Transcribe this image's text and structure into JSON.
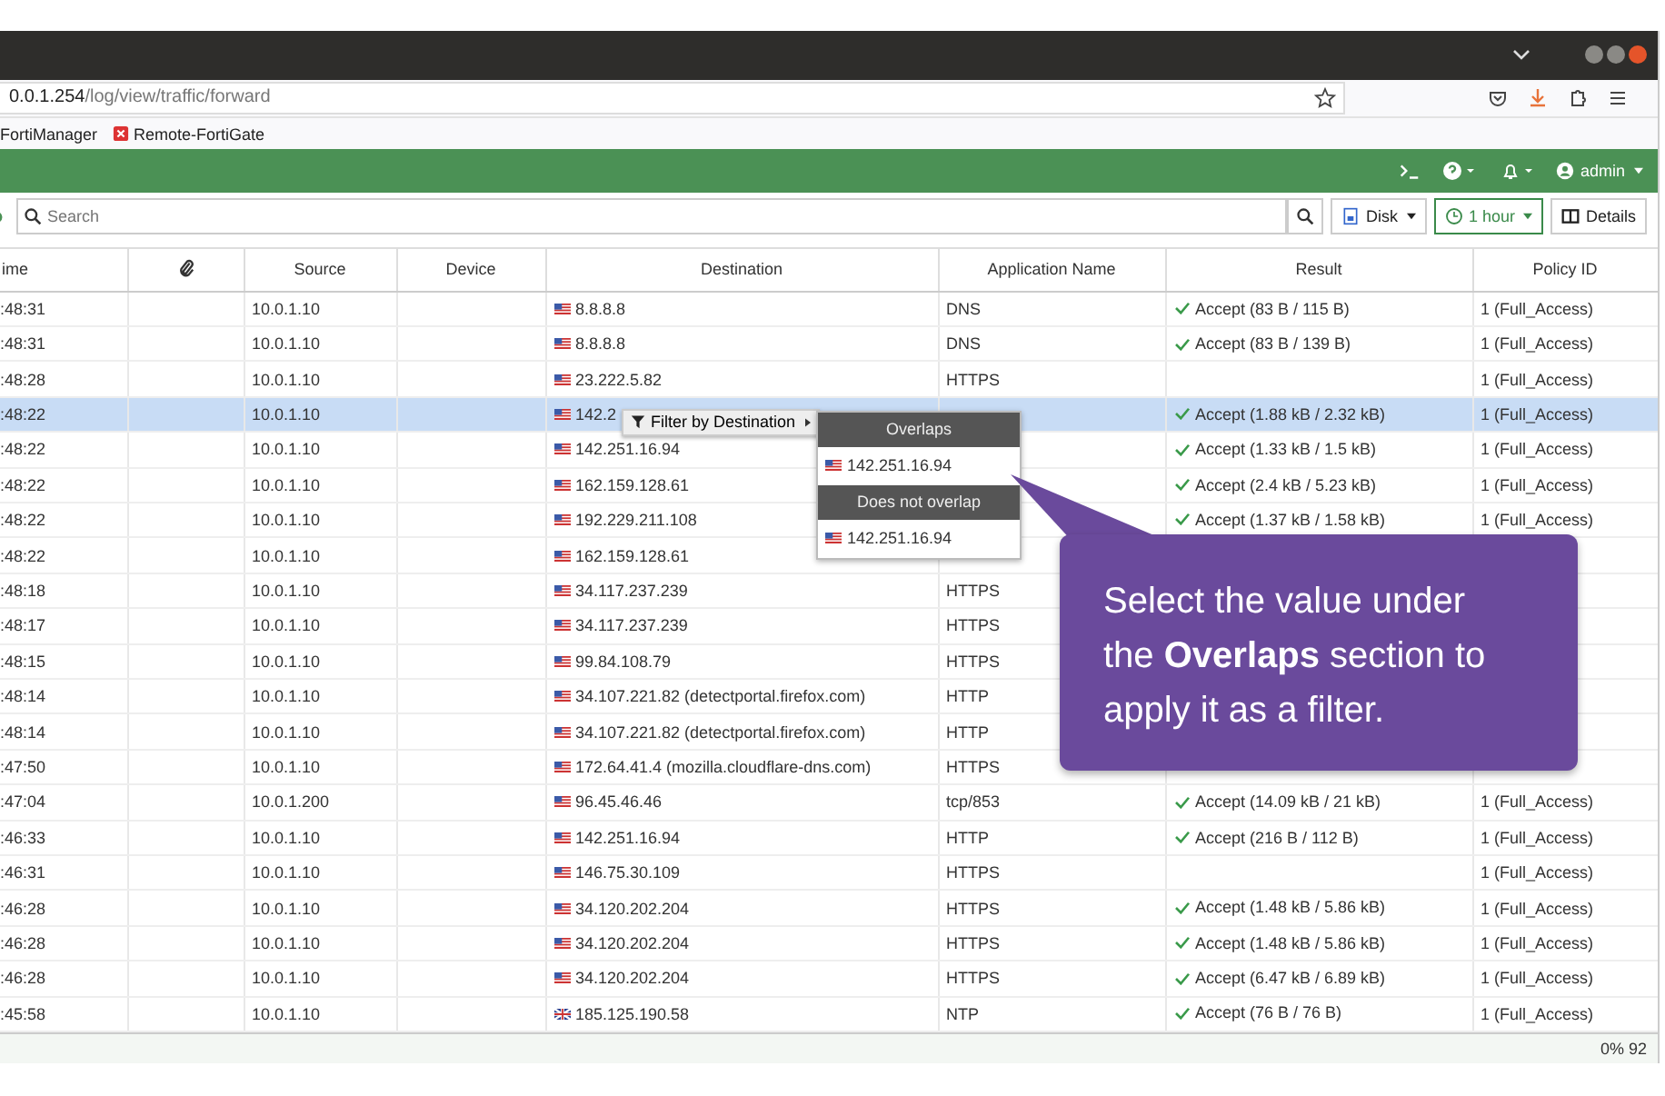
{
  "browser": {
    "url_host": "0.0.1.254",
    "url_path": "/log/view/traffic/forward",
    "bookmarks": [
      {
        "label": "FortiManager",
        "kind": "plain"
      },
      {
        "label": "Remote-FortiGate",
        "kind": "red"
      }
    ]
  },
  "header": {
    "user": "admin"
  },
  "toolbar": {
    "search": {
      "placeholder": "Search"
    },
    "disk": "Disk",
    "time_range": "1 hour",
    "details": "Details"
  },
  "table": {
    "columns": [
      "ime",
      "",
      "Source",
      "Device",
      "Destination",
      "Application Name",
      "Result",
      "Policy ID"
    ],
    "rows": [
      {
        "time": ":48:31",
        "source": "10.0.1.10",
        "dest": "8.8.8.8",
        "kind": "us",
        "app": "DNS",
        "result": "Accept (83 B / 115 B)",
        "policy": "1 (Full_Access)",
        "selected": false
      },
      {
        "time": ":48:31",
        "source": "10.0.1.10",
        "dest": "8.8.8.8",
        "kind": "us",
        "app": "DNS",
        "result": "Accept (83 B / 139 B)",
        "policy": "1 (Full_Access)",
        "selected": false
      },
      {
        "time": ":48:28",
        "source": "10.0.1.10",
        "dest": "23.222.5.82",
        "kind": "us",
        "app": "HTTPS",
        "policy": "1 (Full_Access)",
        "selected": false
      },
      {
        "time": ":48:22",
        "source": "10.0.1.10",
        "dest": "142.2",
        "kind": "us",
        "result": "Accept (1.88 kB / 2.32 kB)",
        "policy": "1 (Full_Access)",
        "selected": true
      },
      {
        "time": ":48:22",
        "source": "10.0.1.10",
        "dest": "142.251.16.94",
        "kind": "us",
        "result": "Accept (1.33 kB / 1.5 kB)",
        "policy": "1 (Full_Access)",
        "selected": false
      },
      {
        "time": ":48:22",
        "source": "10.0.1.10",
        "dest": "162.159.128.61",
        "kind": "us",
        "result": "Accept (2.4 kB / 5.23 kB)",
        "policy": "1 (Full_Access)",
        "selected": false
      },
      {
        "time": ":48:22",
        "source": "10.0.1.10",
        "dest": "192.229.211.108",
        "kind": "us",
        "result": "Accept (1.37 kB / 1.58 kB)",
        "policy": "1 (Full_Access)",
        "selected": false
      },
      {
        "time": ":48:22",
        "source": "10.0.1.10",
        "dest": "162.159.128.61",
        "kind": "us",
        "selected": false
      },
      {
        "time": ":48:18",
        "source": "10.0.1.10",
        "dest": "34.117.237.239",
        "kind": "us",
        "app": "HTTPS",
        "selected": false
      },
      {
        "time": ":48:17",
        "source": "10.0.1.10",
        "dest": "34.117.237.239",
        "kind": "us",
        "app": "HTTPS",
        "selected": false
      },
      {
        "time": ":48:15",
        "source": "10.0.1.10",
        "dest": "99.84.108.79",
        "kind": "us",
        "app": "HTTPS",
        "selected": false
      },
      {
        "time": ":48:14",
        "source": "10.0.1.10",
        "dest": "34.107.221.82 (detectportal.firefox.com)",
        "kind": "us",
        "app": "HTTP",
        "selected": false
      },
      {
        "time": ":48:14",
        "source": "10.0.1.10",
        "dest": "34.107.221.82 (detectportal.firefox.com)",
        "kind": "us",
        "app": "HTTP",
        "selected": false
      },
      {
        "time": ":47:50",
        "source": "10.0.1.10",
        "dest": "172.64.41.4 (mozilla.cloudflare-dns.com)",
        "kind": "us",
        "app": "HTTPS",
        "selected": false
      },
      {
        "time": ":47:04",
        "source": "10.0.1.200",
        "dest": "96.45.46.46",
        "kind": "us",
        "app": "tcp/853",
        "result": "Accept (14.09 kB / 21 kB)",
        "policy": "1 (Full_Access)",
        "selected": false
      },
      {
        "time": ":46:33",
        "source": "10.0.1.10",
        "dest": "142.251.16.94",
        "kind": "us",
        "app": "HTTP",
        "result": "Accept (216 B / 112 B)",
        "policy": "1 (Full_Access)",
        "selected": false
      },
      {
        "time": ":46:31",
        "source": "10.0.1.10",
        "dest": "146.75.30.109",
        "kind": "us",
        "app": "HTTPS",
        "policy": "1 (Full_Access)",
        "selected": false
      },
      {
        "time": ":46:28",
        "source": "10.0.1.10",
        "dest": "34.120.202.204",
        "kind": "us",
        "app": "HTTPS",
        "result": "Accept (1.48 kB / 5.86 kB)",
        "policy": "1 (Full_Access)",
        "selected": false
      },
      {
        "time": ":46:28",
        "source": "10.0.1.10",
        "dest": "34.120.202.204",
        "kind": "us",
        "app": "HTTPS",
        "result": "Accept (1.48 kB / 5.86 kB)",
        "policy": "1 (Full_Access)",
        "selected": false
      },
      {
        "time": ":46:28",
        "source": "10.0.1.10",
        "dest": "34.120.202.204",
        "kind": "us",
        "app": "HTTPS",
        "result": "Accept (6.47 kB / 6.89 kB)",
        "policy": "1 (Full_Access)",
        "selected": false
      },
      {
        "time": ":45:58",
        "source": "10.0.1.10",
        "dest": "185.125.190.58",
        "kind": "gb",
        "app": "NTP",
        "result": "Accept (76 B / 76 B)",
        "policy": "1 (Full_Access)",
        "selected": false
      }
    ]
  },
  "context_menu": {
    "label": "Filter by Destination",
    "sections": [
      {
        "title": "Overlaps",
        "value": "142.251.16.94",
        "kind": "us"
      },
      {
        "title": "Does not overlap",
        "value": "142.251.16.94",
        "kind": "us"
      }
    ]
  },
  "callout": {
    "text": "Select the value under the **Overlaps** section to apply it as a filter."
  },
  "footer": {
    "text": "0% 92"
  }
}
